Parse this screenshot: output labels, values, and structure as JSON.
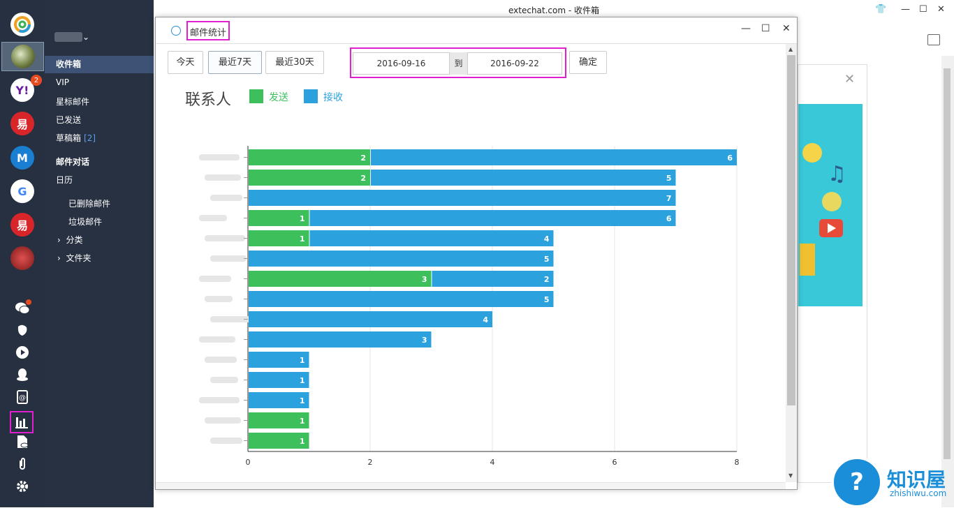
{
  "window": {
    "title": "extechat.com - 收件箱"
  },
  "accounts": [
    {
      "name": "aol-like",
      "badge": ""
    },
    {
      "name": "selected-avatar",
      "badge": ""
    },
    {
      "name": "yahoo",
      "badge": "2",
      "glyph": "Y!"
    },
    {
      "name": "netease-163",
      "badge": "",
      "glyph": "易"
    },
    {
      "name": "mail",
      "badge": "",
      "glyph": "M"
    },
    {
      "name": "google",
      "badge": "",
      "glyph": "G"
    },
    {
      "name": "netease-126",
      "badge": "",
      "glyph": "易"
    },
    {
      "name": "flower-avatar",
      "badge": ""
    }
  ],
  "folders": {
    "inbox": "收件箱",
    "vip": "VIP",
    "starred": "星标邮件",
    "sent": "已发送",
    "drafts": "草稿箱",
    "drafts_count": "[2]",
    "conversations": "邮件对话",
    "calendar": "日历",
    "deleted": "已删除邮件",
    "junk": "垃圾邮件",
    "categories": "分类",
    "folders": "文件夹"
  },
  "dialog": {
    "title": "邮件统计",
    "buttons": {
      "today": "今天",
      "last7": "最近7天",
      "last30": "最近30天",
      "confirm": "确定"
    },
    "date_from": "2016-09-16",
    "date_to_label": "到",
    "date_to": "2016-09-22"
  },
  "colors": {
    "sent": "#3dbf5c",
    "received": "#2ba2dd",
    "highlight": "#e020d0",
    "rail": "#263040"
  },
  "chart_data": {
    "type": "bar",
    "orientation": "horizontal",
    "stacked": true,
    "title": "联系人",
    "categories": [
      "",
      "",
      "",
      "",
      "",
      "",
      "",
      "",
      "",
      "",
      "",
      "",
      "",
      "",
      ""
    ],
    "series": [
      {
        "name": "发送",
        "values": [
          2,
          2,
          0,
          1,
          1,
          0,
          3,
          0,
          0,
          0,
          0,
          0,
          0,
          1,
          1
        ]
      },
      {
        "name": "接收",
        "values": [
          6,
          5,
          7,
          6,
          4,
          5,
          2,
          5,
          4,
          3,
          1,
          1,
          1,
          0,
          0
        ]
      }
    ],
    "xticks": [
      "0",
      "2",
      "4",
      "6",
      "8"
    ],
    "xlim": [
      0,
      8
    ],
    "grid": true,
    "legend": "top-left"
  },
  "watermark": {
    "name": "知识屋",
    "url": "zhishiwu.com"
  }
}
